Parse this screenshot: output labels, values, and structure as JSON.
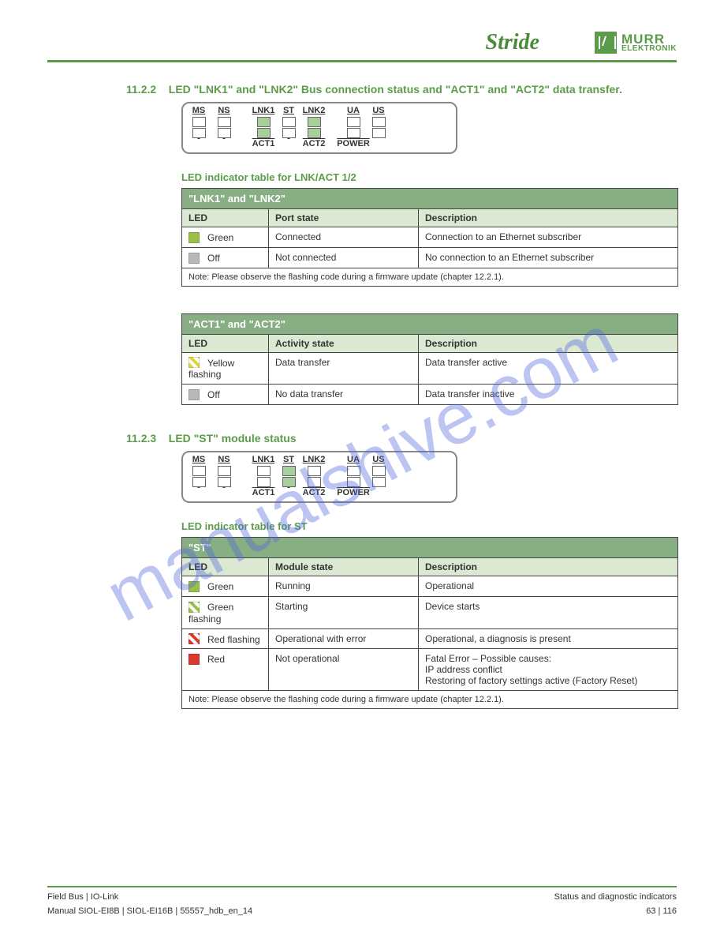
{
  "header": {
    "logo1": "Stride",
    "logo2_big": "MURR",
    "logo2_small": "ELEKTRONIK"
  },
  "section_lnk": {
    "num": "11.2.2",
    "title": "LED \"LNK1\" and \"LNK2\" Bus connection status and \"ACT1\" and \"ACT2\" data transfer."
  },
  "panel_labels": {
    "top": [
      "MS",
      "NS",
      "LNK1",
      "ST",
      "LNK2",
      "UA",
      "US"
    ],
    "bottom_act1": "ACT1",
    "bottom_act2": "ACT2",
    "bottom_power": "POWER"
  },
  "table_lnk": {
    "title": "LED indicator table for LNK/ACT 1/2",
    "bar": "\"LNK1\" and \"LNK2\"",
    "cols": [
      "LED",
      "Port state",
      "Description"
    ],
    "rows": [
      {
        "swatch": "green",
        "led": "Green",
        "state": "Connected",
        "desc": "Connection to an Ethernet subscriber"
      },
      {
        "swatch": "gray",
        "led": "Off",
        "state": "Not connected",
        "desc": "No connection to an Ethernet subscriber"
      }
    ],
    "note": "Note: Please observe the flashing code during a firmware update (chapter 12.2.1)."
  },
  "table_act": {
    "bar": "\"ACT1\" and \"ACT2\"",
    "cols": [
      "LED",
      "Activity state",
      "Description"
    ],
    "rows": [
      {
        "swatch": "yellow-flash",
        "led": "Yellow flashing",
        "state": "Data transfer",
        "desc": "Data transfer active"
      },
      {
        "swatch": "gray",
        "led": "Off",
        "state": "No data transfer",
        "desc": "Data transfer inactive"
      }
    ]
  },
  "section_st": {
    "num": "11.2.3",
    "title": "LED \"ST\" module status"
  },
  "table_st": {
    "title": "LED indicator table for ST",
    "bar": "\"ST\"",
    "cols": [
      "LED",
      "Module state",
      "Description"
    ],
    "rows": [
      {
        "swatch": "green",
        "led": "Green",
        "state": "Running",
        "desc": "Operational"
      },
      {
        "swatch": "green-flash",
        "led": "Green flashing",
        "state": "Starting",
        "desc": "Device starts"
      },
      {
        "swatch": "red-flash",
        "led": "Red flashing",
        "state": "Operational with error",
        "desc": "Operational, a diagnosis is present"
      },
      {
        "swatch": "red",
        "led": "Red",
        "state": "Not operational",
        "desc": "Fatal Error – Possible causes:\nIP address conflict\nRestoring of factory settings active (Factory Reset)"
      }
    ],
    "note": "Note: Please observe the flashing code during a firmware update (chapter 12.2.1)."
  },
  "footer": {
    "left": "Field Bus | IO-Link",
    "right": "Status and diagnostic indicators",
    "manual": "Manual SIOL-EI8B | SIOL-EI16B | 55557_hdb_en_14",
    "page": "63 | 116"
  },
  "watermark": "manualshive.com"
}
